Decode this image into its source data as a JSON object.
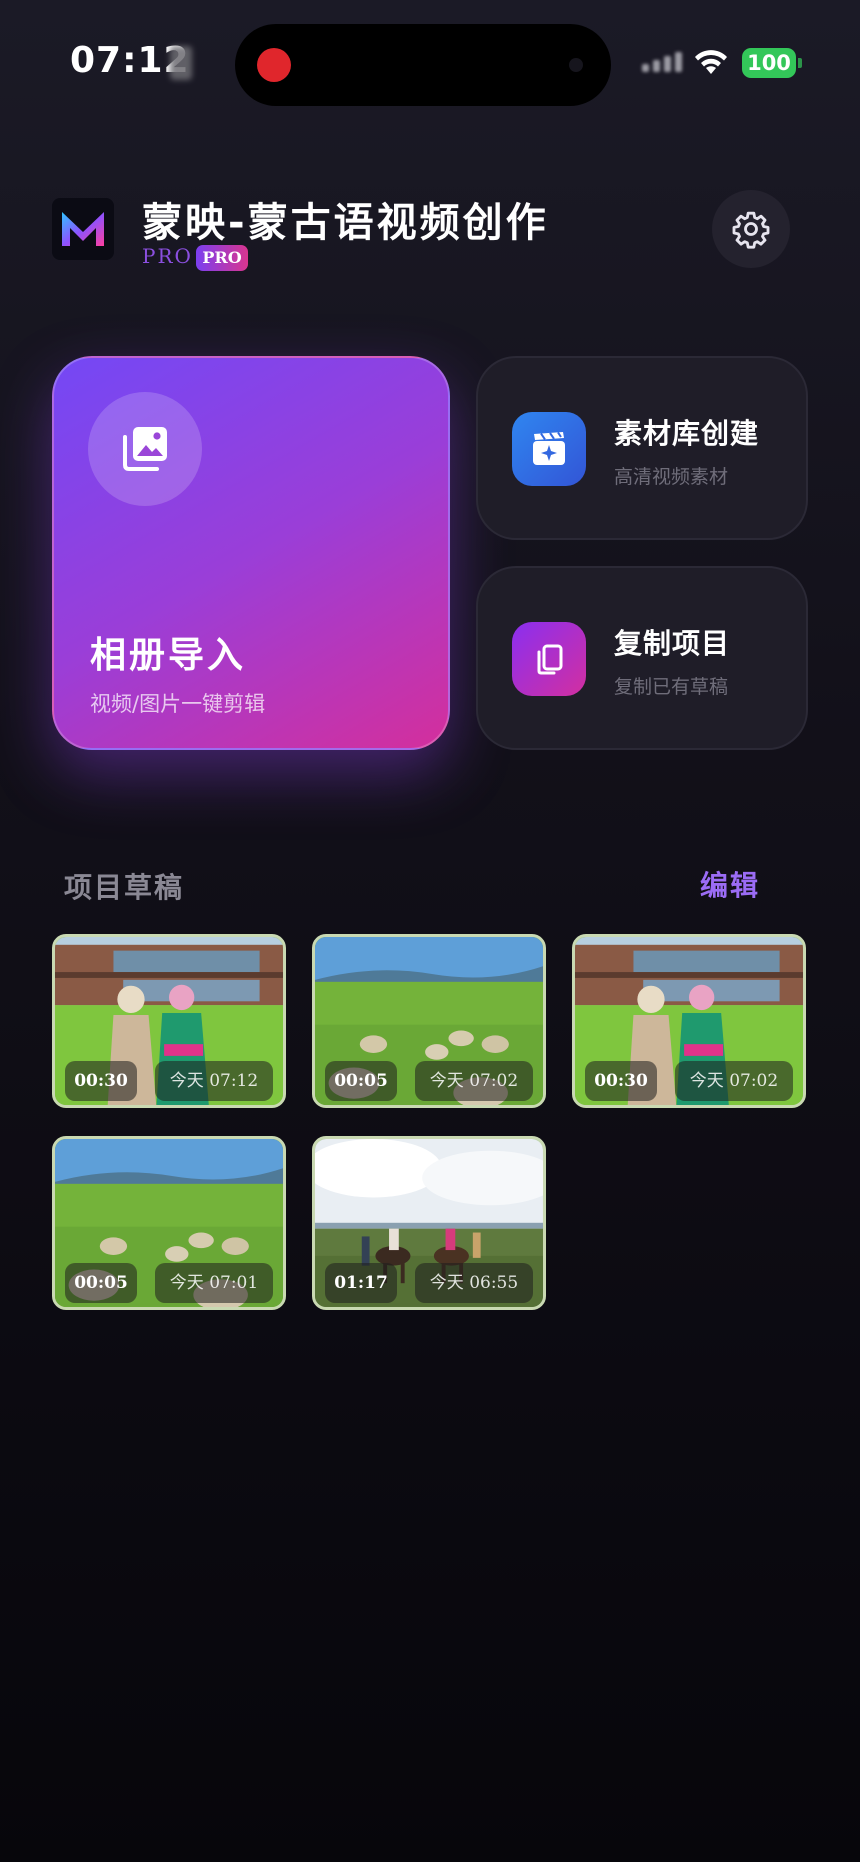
{
  "status_bar": {
    "time": "07:12",
    "battery": "100",
    "colors": {
      "battery": "#33c759",
      "recording": "#e0262c"
    }
  },
  "header": {
    "app_title": "蒙映-蒙古语视频创作",
    "pro_text": "PRO",
    "pro_badge": "PRO",
    "logo_letter": "M",
    "settings_icon": "gear-icon"
  },
  "actions": {
    "album": {
      "title": "相册导入",
      "subtitle": "视频/图片一键剪辑",
      "icon": "photo-album-icon"
    },
    "library": {
      "title": "素材库创建",
      "subtitle": "高清视频素材",
      "icon": "clapperboard-sparkle-icon"
    },
    "copy": {
      "title": "复制项目",
      "subtitle": "复制已有草稿",
      "icon": "copy-icon"
    }
  },
  "drafts": {
    "title": "项目草稿",
    "edit_label": "编辑",
    "items": [
      {
        "duration": "00:30",
        "date": "今天 07:12",
        "scene": "house-couple"
      },
      {
        "duration": "00:05",
        "date": "今天 07:02",
        "scene": "grassland-sheep"
      },
      {
        "duration": "00:30",
        "date": "今天 07:02",
        "scene": "house-couple"
      },
      {
        "duration": "00:05",
        "date": "今天 07:01",
        "scene": "grassland-sheep"
      },
      {
        "duration": "01:17",
        "date": "今天 06:55",
        "scene": "horse-riders"
      }
    ]
  },
  "theme": {
    "accent": "#9b6cf5",
    "album_gradient": [
      "#7448f5",
      "#d42f9c"
    ],
    "card_bg": "#1f1d28"
  }
}
